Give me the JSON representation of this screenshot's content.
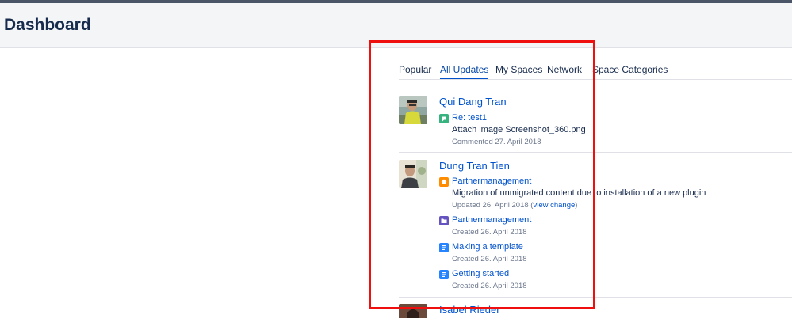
{
  "header": {
    "title": "Dashboard"
  },
  "tabs": [
    {
      "label": "Popular"
    },
    {
      "label": "All Updates",
      "active": true
    },
    {
      "label": "My Spaces"
    },
    {
      "label": "Network"
    },
    {
      "label": "Space Categories"
    }
  ],
  "feed": [
    {
      "user": "Qui Dang Tran",
      "entries": [
        {
          "icon": "comment-icon",
          "icon_color": "#36b37e",
          "title": "Re: test1",
          "description": "Attach image Screenshot_360.png",
          "meta": "Commented 27. April 2018"
        }
      ]
    },
    {
      "user": "Dung Tran Tien",
      "entries": [
        {
          "icon": "home-icon",
          "icon_color": "#ff8b00",
          "title": "Partnermanagement",
          "description": "Migration of unmigrated content due to installation of a new plugin",
          "meta": "Updated 26. April 2018",
          "meta_link": "view change"
        },
        {
          "icon": "folder-icon",
          "icon_color": "#6554c0",
          "title": "Partnermanagement",
          "meta": "Created 26. April 2018"
        },
        {
          "icon": "page-icon",
          "icon_color": "#2684ff",
          "title": "Making a template",
          "meta": "Created 26. April 2018"
        },
        {
          "icon": "page-icon",
          "icon_color": "#2684ff",
          "title": "Getting started",
          "meta": "Created 26. April 2018"
        }
      ]
    },
    {
      "user": "Isabel Rieder",
      "entries": []
    }
  ],
  "colors": {
    "link": "#0052cc",
    "highlight": "#f00f0f",
    "header_bg": "#f4f5f7"
  }
}
